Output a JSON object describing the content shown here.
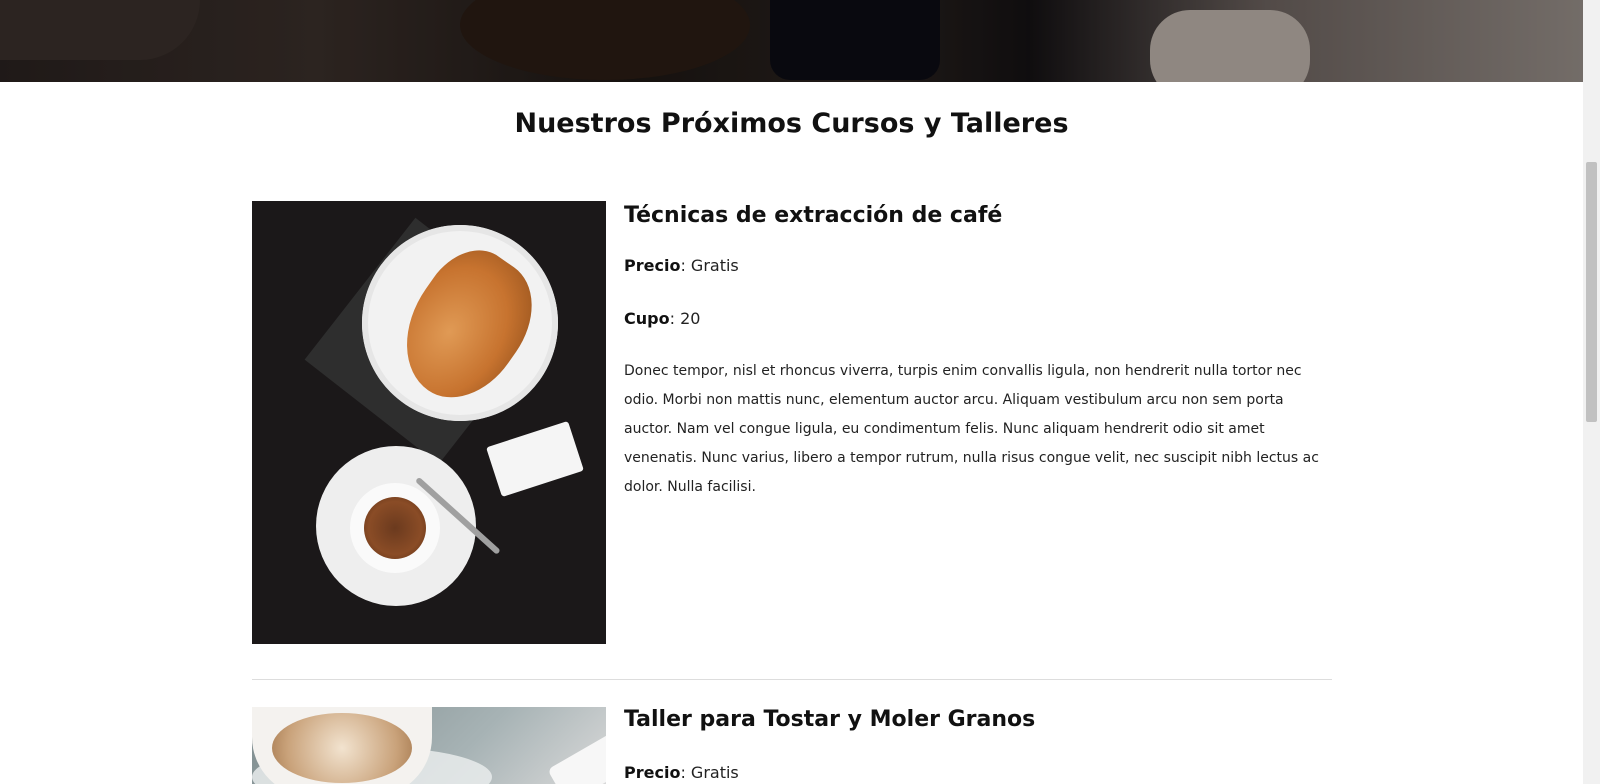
{
  "section": {
    "title": "Nuestros Próximos Cursos y Talleres"
  },
  "courses": [
    {
      "title": "Técnicas de extracción de café",
      "price_label": "Precio",
      "price_value": "Gratis",
      "quota_label": "Cupo",
      "quota_value": "20",
      "description": "Donec tempor, nisl et rhoncus viverra, turpis enim convallis ligula, non hendrerit nulla tortor nec odio. Morbi non mattis nunc, elementum auctor arcu. Aliquam vestibulum arcu non sem porta auctor. Nam vel congue ligula, eu condimentum felis. Nunc aliquam hendrerit odio sit amet venenatis. Nunc varius, libero a tempor rutrum, nulla risus congue velit, nec suscipit nibh lectus ac dolor. Nulla facilisi.",
      "image_icon": "croissant-espresso-photo"
    },
    {
      "title": "Taller para Tostar y Moler Granos",
      "price_label": "Precio",
      "price_value": "Gratis",
      "image_icon": "latte-photo"
    }
  ],
  "colors": {
    "text": "#111111",
    "divider": "#dddddd",
    "background": "#ffffff"
  }
}
